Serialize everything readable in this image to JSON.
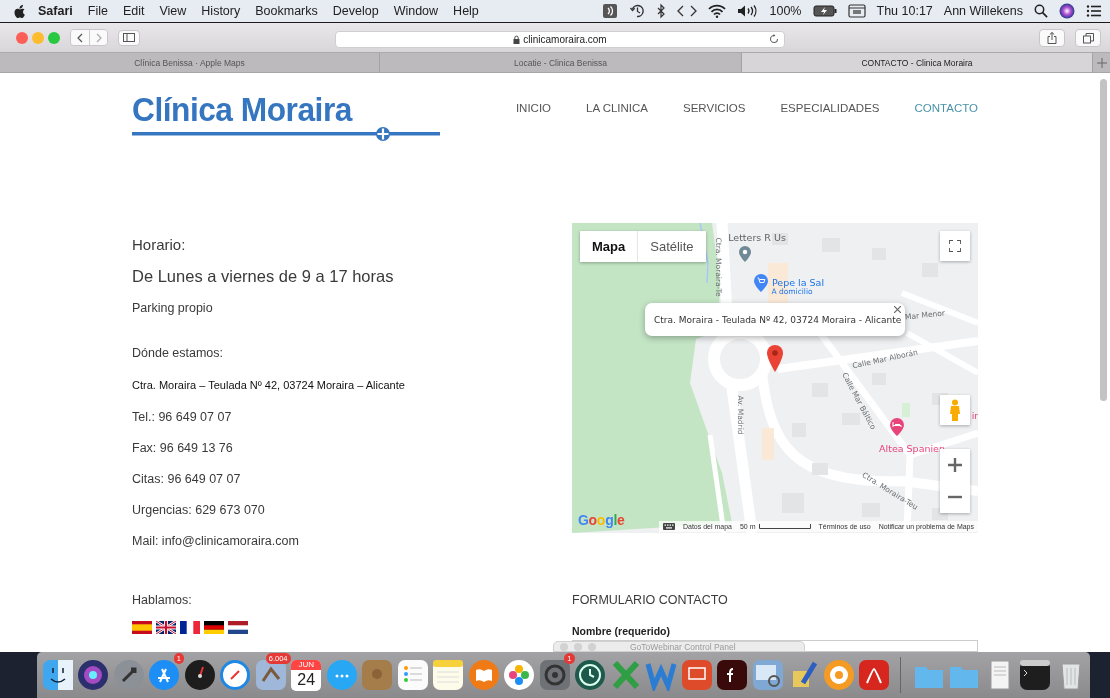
{
  "menu_bar": {
    "app": "Safari",
    "menus": [
      "File",
      "Edit",
      "View",
      "History",
      "Bookmarks",
      "Develop",
      "Window",
      "Help"
    ],
    "battery": "100%",
    "clock": "Thu 10:17",
    "user": "Ann Willekens"
  },
  "toolbar": {
    "address": "clinicamoraira.com"
  },
  "tabs": [
    {
      "label": "Clínica Benissa · Apple Maps",
      "selected": false
    },
    {
      "label": "Locatie - Clinica Benissa",
      "selected": false
    },
    {
      "label": "CONTACTO - Clinica Moraira",
      "selected": true
    }
  ],
  "site": {
    "logo": "Clínica Moraira",
    "nav": [
      {
        "label": "INICIO",
        "selected": false
      },
      {
        "label": "LA CLINICA",
        "selected": false
      },
      {
        "label": "SERVICIOS",
        "selected": false
      },
      {
        "label": "ESPECIALIDADES",
        "selected": false
      },
      {
        "label": "CONTACTO",
        "selected": true
      }
    ]
  },
  "info": [
    {
      "kind": "heading",
      "text": "Horario:"
    },
    {
      "kind": "large",
      "text": "De Lunes a viernes de 9 a 17 horas"
    },
    {
      "kind": "text",
      "text": "Parking propio"
    },
    {
      "kind": "label",
      "text": "Dónde estamos:"
    },
    {
      "kind": "address",
      "text": "Ctra. Moraira – Teulada Nº 42, 03724 Moraira – Alicante"
    },
    {
      "kind": "text",
      "text": "Tel.: 96 649 07 07"
    },
    {
      "kind": "text",
      "text": "Fax: 96 649 13 76"
    },
    {
      "kind": "text",
      "text": "Citas: 96 649 07 07"
    },
    {
      "kind": "text",
      "text": "Urgencias: 629 673 070"
    },
    {
      "kind": "text",
      "text": "Mail: info@clinicamoraira.com"
    }
  ],
  "languages": {
    "heading": "Hablamos:"
  },
  "map": {
    "view_tabs": [
      {
        "label": "Mapa",
        "selected": true
      },
      {
        "label": "Satélite",
        "selected": false
      }
    ],
    "labels": [
      {
        "kind": "place",
        "text": "Letters R Us"
      },
      {
        "kind": "shop",
        "text": "Pepe la Sal"
      },
      {
        "kind": "shop-note",
        "text": "A domicilio"
      },
      {
        "kind": "street",
        "text": "Mar Menor"
      },
      {
        "kind": "street",
        "text": "Calle Mar Alborán"
      },
      {
        "kind": "street",
        "text": "Calle Mar Báltico"
      },
      {
        "kind": "street",
        "text": "Av. Madrid"
      },
      {
        "kind": "street",
        "text": "Ctra. Moraira-Te"
      },
      {
        "kind": "street",
        "text": "Ctra. Moraira-Teu"
      },
      {
        "kind": "hotel",
        "text": "Altea Spanien"
      },
      {
        "kind": "hotel",
        "text": "ir"
      }
    ],
    "popup": "Ctra. Moraira - Teulada Nº 42, 03724 Moraira - Alicante",
    "logo": "Google",
    "footer": [
      "Datos del mapa",
      "50 m",
      "Términos de uso",
      "Notificar un problema de Maps"
    ]
  },
  "form": {
    "heading": "FORMULARIO CONTACTO",
    "fields": [
      {
        "label": "Nombre (requerido)"
      }
    ]
  },
  "panel": {
    "title": "GoToWebinar Control Panel"
  },
  "dock": {
    "badges": [
      "1",
      "6.004",
      "1"
    ],
    "calendar": {
      "month": "JUN",
      "day": "24"
    }
  }
}
